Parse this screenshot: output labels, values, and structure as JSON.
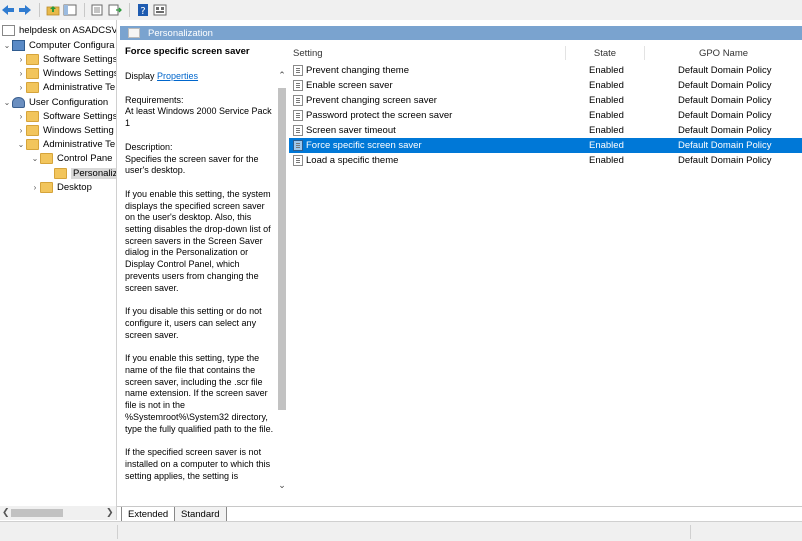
{
  "toolbar": {
    "buttons": [
      "back-icon",
      "forward-icon",
      "up-folder-icon",
      "show-hide-tree-icon",
      "export-list-icon",
      "filter-icon",
      "help-icon",
      "properties-icon"
    ]
  },
  "tree": {
    "root": "helpdesk on ASADCSVR",
    "computer_config": "Computer Configura",
    "cc_software": "Software Settings",
    "cc_windows": "Windows Settings",
    "cc_admin": "Administrative Te",
    "user_config": "User Configuration",
    "uc_software": "Software Settings",
    "uc_windows": "Windows Setting",
    "uc_admin": "Administrative Te",
    "control_panel": "Control Pane",
    "personalization": "Personaliz",
    "desktop": "Desktop"
  },
  "header": {
    "title": "Personalization"
  },
  "description": {
    "title": "Force specific screen saver",
    "display_label": "Display",
    "properties_link": "Properties",
    "requirements_label": "Requirements:",
    "requirements_text": "At least Windows 2000 Service Pack 1",
    "description_label": "Description:",
    "description_text": "Specifies the screen saver for the user's desktop.",
    "para1": "If you enable this setting, the system displays the specified screen saver on the user's desktop. Also, this setting disables the drop-down list of screen savers in the Screen Saver dialog in the Personalization or Display Control Panel, which prevents users from changing the screen saver.",
    "para2": "If you disable this setting or do not configure it, users can select any screen saver.",
    "para3": "If you enable this setting, type the name of the file that contains the screen saver, including the .scr file name extension. If the screen saver file is not in the %Systemroot%\\System32 directory, type the fully qualified path to the file.",
    "para4": "If the specified screen saver is not installed on a computer to which this setting applies, the setting is"
  },
  "table": {
    "columns": [
      "Setting",
      "State",
      "GPO Name"
    ],
    "rows": [
      {
        "setting": "Prevent changing theme",
        "state": "Enabled",
        "gpo": "Default Domain Policy"
      },
      {
        "setting": "Enable screen saver",
        "state": "Enabled",
        "gpo": "Default Domain Policy"
      },
      {
        "setting": "Prevent changing screen saver",
        "state": "Enabled",
        "gpo": "Default Domain Policy"
      },
      {
        "setting": "Password protect the screen saver",
        "state": "Enabled",
        "gpo": "Default Domain Policy"
      },
      {
        "setting": "Screen saver timeout",
        "state": "Enabled",
        "gpo": "Default Domain Policy"
      },
      {
        "setting": "Force specific screen saver",
        "state": "Enabled",
        "gpo": "Default Domain Policy"
      },
      {
        "setting": "Load a specific theme",
        "state": "Enabled",
        "gpo": "Default Domain Policy"
      }
    ],
    "selected_index": 5
  },
  "tabs": {
    "extended": "Extended",
    "standard": "Standard"
  },
  "colors": {
    "header_bg": "#7aa3cf",
    "selection": "#0078d7",
    "link": "#0066cc"
  }
}
